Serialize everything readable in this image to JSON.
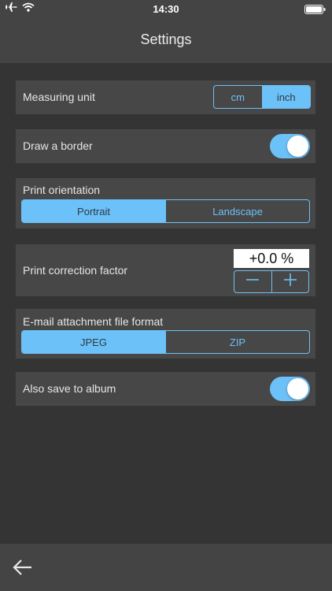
{
  "status_bar": {
    "time": "14:30",
    "icons": [
      "airplane-icon",
      "wifi-icon",
      "battery-icon"
    ]
  },
  "header": {
    "title": "Settings"
  },
  "settings": {
    "measuring_unit": {
      "label": "Measuring unit",
      "options": [
        "cm",
        "inch"
      ],
      "selected": "inch"
    },
    "draw_border": {
      "label": "Draw a border",
      "on": true
    },
    "print_orientation": {
      "label": "Print orientation",
      "options": [
        "Portrait",
        "Landscape"
      ],
      "selected": "Portrait"
    },
    "print_correction": {
      "label": "Print correction factor",
      "value": "+0.0 %",
      "decrement_icon": "minus-icon",
      "increment_icon": "plus-icon"
    },
    "email_format": {
      "label": "E-mail attachment file format",
      "options": [
        "JPEG",
        "ZIP"
      ],
      "selected": "JPEG"
    },
    "save_to_album": {
      "label": "Also save to album",
      "on": true
    }
  },
  "footer": {
    "back_icon": "back-arrow-icon"
  },
  "colors": {
    "accent": "#6cc1f8",
    "background": "#343434",
    "card": "#474747",
    "bar": "#444444"
  }
}
